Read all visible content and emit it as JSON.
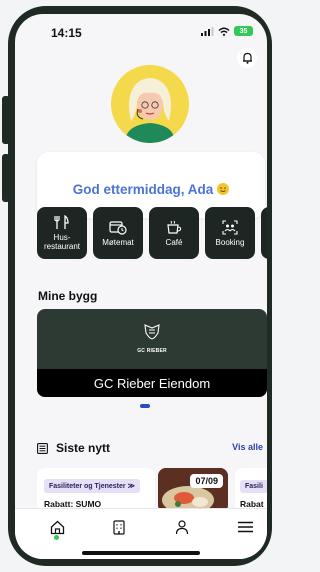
{
  "status_bar": {
    "time": "14:15",
    "battery": "35"
  },
  "greeting": {
    "text": "God ettermiddag, Ada"
  },
  "tiles": [
    {
      "label": "Hus-\nrestaurant",
      "icon": "fork-knife-icon"
    },
    {
      "label": "Møtemat",
      "icon": "calendar-clock-icon"
    },
    {
      "label": "Café",
      "icon": "coffee-cup-icon"
    },
    {
      "label": "Booking",
      "icon": "people-scan-icon"
    }
  ],
  "buildings": {
    "title": "Mine bygg",
    "logo_text": "GC RIEBER",
    "name": "GC Rieber Eiendom"
  },
  "news": {
    "title": "Siste nytt",
    "see_all": "Vis alle",
    "items": [
      {
        "tag": "Fasiliteter og Tjenester",
        "title": "Rabatt: SUMO"
      },
      {
        "date": "07/09"
      },
      {
        "tag": "Fasili",
        "title": "Rabat"
      }
    ]
  },
  "nav": [
    {
      "icon": "home-icon"
    },
    {
      "icon": "building-icon"
    },
    {
      "icon": "person-icon"
    },
    {
      "icon": "menu-icon"
    }
  ],
  "colors": {
    "accent": "#4a74d4",
    "tile_bg": "#1d2622",
    "active": "#35c759"
  }
}
